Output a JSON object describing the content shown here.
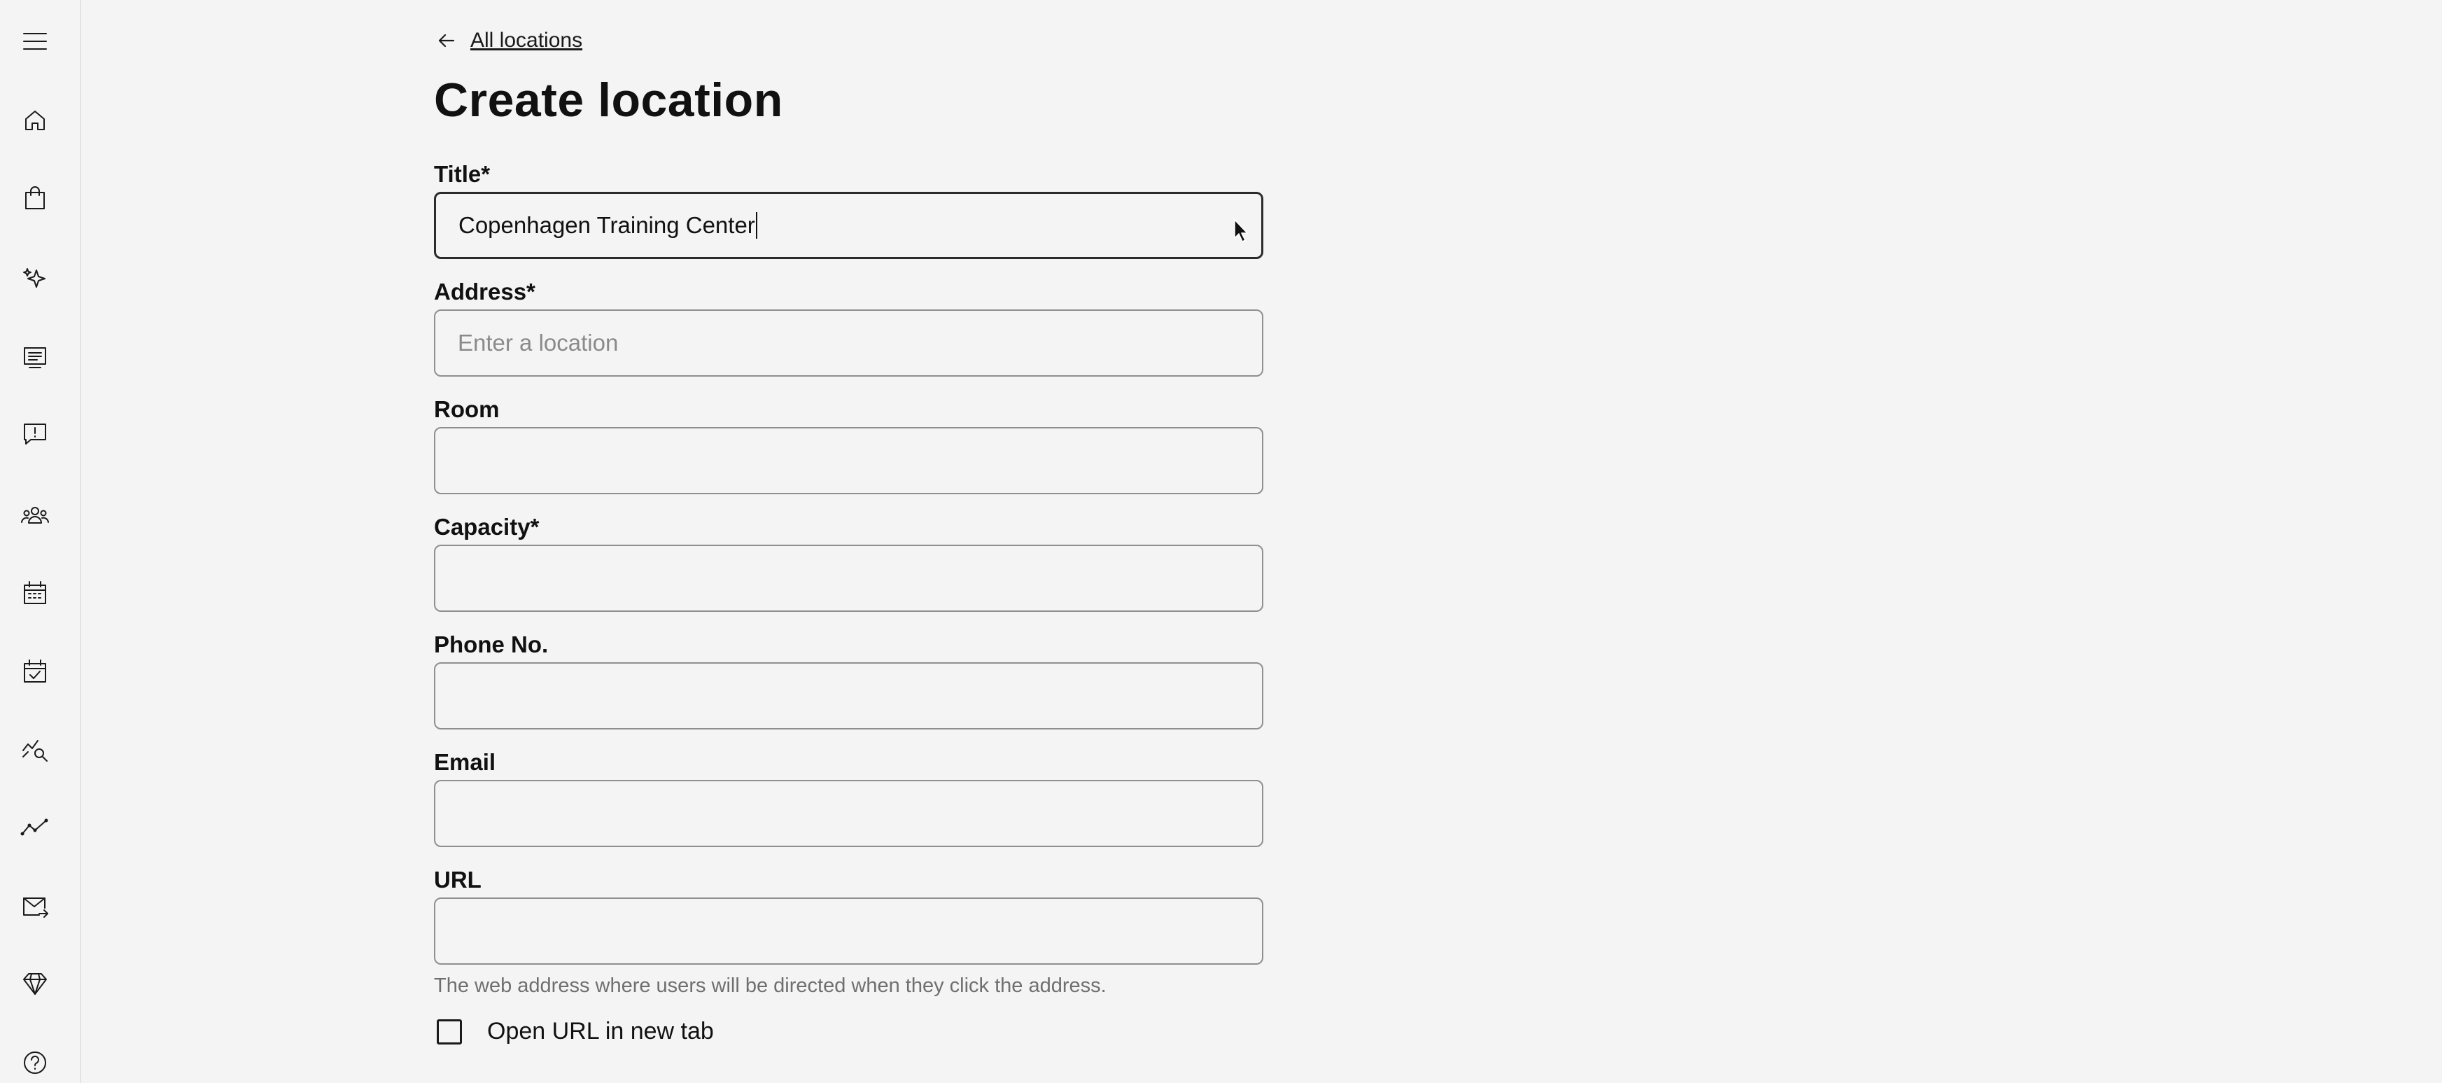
{
  "sidebar": {
    "items": [
      {
        "icon": "menu-icon"
      },
      {
        "icon": "home-icon"
      },
      {
        "icon": "shopping-bag-icon"
      },
      {
        "icon": "sparkles-icon"
      },
      {
        "icon": "course-list-icon"
      },
      {
        "icon": "feedback-alert-icon"
      },
      {
        "icon": "users-group-icon"
      },
      {
        "icon": "calendar-icon"
      },
      {
        "icon": "calendar-check-icon"
      },
      {
        "icon": "analytics-search-icon"
      },
      {
        "icon": "trend-line-icon"
      },
      {
        "icon": "mail-send-icon"
      },
      {
        "icon": "diamond-icon"
      },
      {
        "icon": "help-icon"
      }
    ]
  },
  "breadcrumb": {
    "back_label": "All locations"
  },
  "page": {
    "title": "Create location"
  },
  "form": {
    "title": {
      "label": "Title*",
      "value": "Copenhagen Training Center"
    },
    "address": {
      "label": "Address*",
      "placeholder": "Enter a location"
    },
    "room": {
      "label": "Room"
    },
    "capacity": {
      "label": "Capacity*"
    },
    "phone": {
      "label": "Phone No."
    },
    "email": {
      "label": "Email"
    },
    "url": {
      "label": "URL",
      "help": "The web address where users will be directed when they click the address."
    },
    "open_new_tab": {
      "label": "Open URL in new tab",
      "checked": false
    }
  }
}
